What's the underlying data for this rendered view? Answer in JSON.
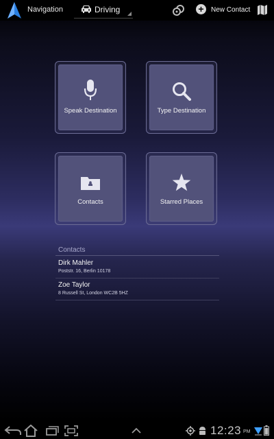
{
  "actionbar": {
    "app_title": "Navigation",
    "mode": "Driving",
    "new_contact_label": "New Contact"
  },
  "tiles": [
    {
      "label": "Speak Destination",
      "icon": "microphone-icon"
    },
    {
      "label": "Type Destination",
      "icon": "search-icon"
    },
    {
      "label": "Contacts",
      "icon": "folder-icon"
    },
    {
      "label": "Starred Places",
      "icon": "star-icon"
    }
  ],
  "contacts": {
    "header": "Contacts",
    "items": [
      {
        "name": "Dirk Mahler",
        "address": "Poststr. 16, Berlin 10178"
      },
      {
        "name": "Zoe Taylor",
        "address": "8 Russell St, London WC2B 5HZ"
      }
    ]
  },
  "statusbar": {
    "time": "12:23",
    "ampm": "PM"
  },
  "colors": {
    "app_icon_blue": "#2a7fe0",
    "tile_fill": "#52527a",
    "tile_border": "#6d6d96"
  }
}
